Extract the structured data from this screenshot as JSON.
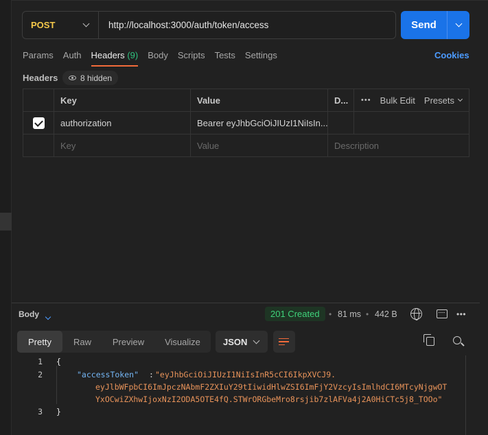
{
  "request": {
    "method": "POST",
    "url": "http://localhost:3000/auth/token/access",
    "send_label": "Send"
  },
  "tabs": [
    {
      "label": "Params"
    },
    {
      "label": "Auth"
    },
    {
      "label": "Headers",
      "count": "(9)",
      "active": true
    },
    {
      "label": "Body"
    },
    {
      "label": "Scripts"
    },
    {
      "label": "Tests"
    },
    {
      "label": "Settings"
    }
  ],
  "cookies_label": "Cookies",
  "headers_section": {
    "title": "Headers",
    "hidden_label": "8 hidden",
    "columns": {
      "key": "Key",
      "value": "Value",
      "description": "D...",
      "bulk_edit": "Bulk Edit",
      "presets": "Presets"
    },
    "rows": [
      {
        "checked": true,
        "key": "authorization",
        "value": "Bearer eyJhbGciOiJIUzI1NiIsIn..."
      }
    ],
    "placeholders": {
      "key": "Key",
      "value": "Value",
      "description": "Description"
    }
  },
  "response": {
    "body_label": "Body",
    "status": "201 Created",
    "time": "81 ms",
    "size": "442 B",
    "views": [
      "Pretty",
      "Raw",
      "Preview",
      "Visualize"
    ],
    "active_view": "Pretty",
    "format": "JSON",
    "lines": [
      {
        "n": "1",
        "text": "{"
      },
      {
        "n": "2",
        "key": "\"accessToken\"",
        "colon": ": ",
        "value_lines": [
          "\"eyJhbGciOiJIUzI1NiIsInR5cCI6IkpXVCJ9.",
          "eyJlbWFpbCI6ImJpczNAbmF2ZXIuY29tIiwidHlwZSI6ImFjY2VzcyIsImlhdCI6MTcyNjgwOT",
          "YxOCwiZXhwIjoxNzI2ODA5OTE4fQ.STWrORGbeMro8rsjib7zlAFVa4j2A0HiCTc5j8_TOOo\""
        ]
      },
      {
        "n": "3",
        "text": "}"
      }
    ]
  },
  "colors": {
    "accent": "#1a73e8",
    "method": "#f5c84a",
    "status_ok": "#3fd27a",
    "active_tab": "#f26b3a",
    "json_key": "#74b6f5",
    "json_string": "#e8935a"
  },
  "icons": [
    "chevron-down-icon",
    "eye-icon",
    "checkbox-icon",
    "more-icon",
    "globe-icon",
    "save-response-icon",
    "wrap-lines-icon",
    "copy-icon",
    "search-icon"
  ]
}
